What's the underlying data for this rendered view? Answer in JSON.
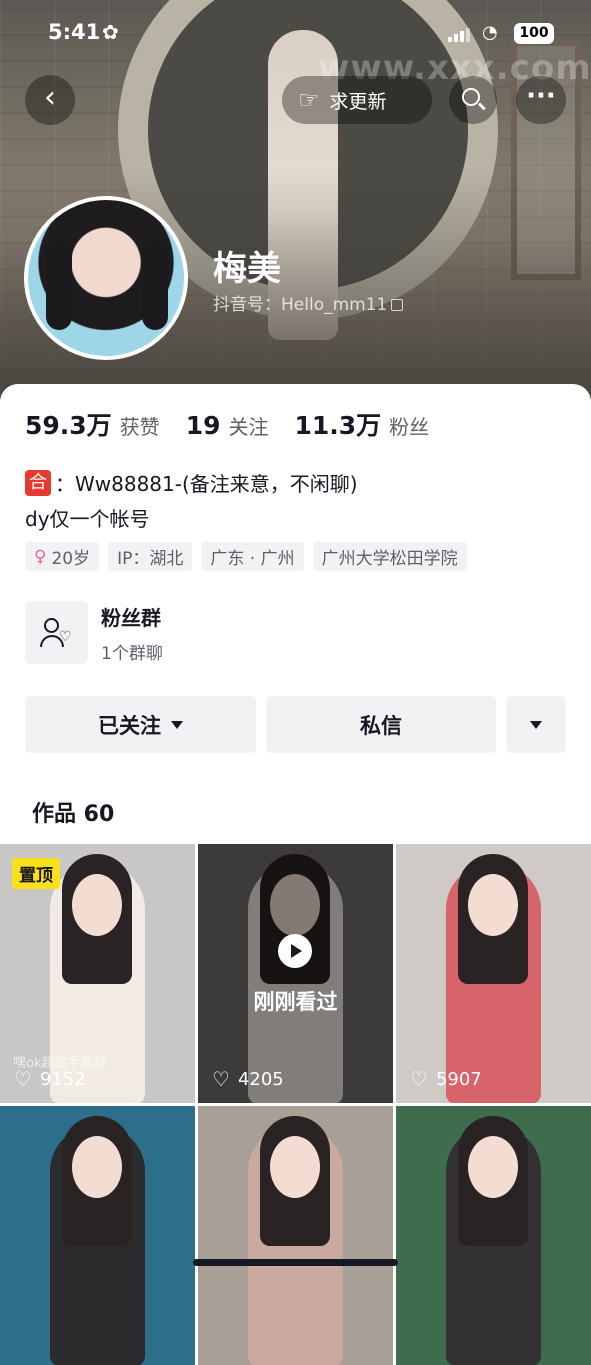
{
  "status_bar": {
    "time": "5:41",
    "flower": "✿",
    "battery": "100"
  },
  "header": {
    "watermark": "www.xxx.com",
    "request_update_label": "求更新",
    "back_icon": "chevron-left-icon",
    "search_icon": "search-icon",
    "more_icon": "more-dots-icon"
  },
  "profile": {
    "nickname": "梅美",
    "douyin_id": "抖音号：Hello_mm11"
  },
  "stats": [
    {
      "value": "59.3万",
      "label": "获赞"
    },
    {
      "value": "19",
      "label": "关注"
    },
    {
      "value": "11.3万",
      "label": "粉丝"
    }
  ],
  "bio": {
    "line1_icon": "合",
    "line1": "：Ww88881-(备注来意，不闲聊)",
    "line2": "dy仅一个帐号"
  },
  "tags": [
    {
      "label": "20岁",
      "icon": "♀"
    },
    {
      "label": "IP：湖北"
    },
    {
      "label": "广东 · 广州"
    },
    {
      "label": "广州大学松田学院"
    }
  ],
  "fans_group": {
    "title": "粉丝群",
    "subtitle": "1个群聊"
  },
  "actions": {
    "follow": "已关注",
    "message": "私信"
  },
  "works": {
    "title": "作品 60",
    "items": [
      {
        "pinned_label": "置顶",
        "overlay": "嘿ok超甜手势舞",
        "likes": "9152",
        "bg": "#c9c7c6",
        "cloth": "#f1ebe3"
      },
      {
        "watched_label": "刚刚看过",
        "likes": "4205",
        "bg": "#6e6c6b",
        "cloth": "#e9e4de"
      },
      {
        "likes": "5907",
        "bg": "#cfcac6",
        "cloth": "#d7636b"
      },
      {
        "bg": "#2d6f8b",
        "cloth": "#2b2b2e"
      },
      {
        "bg": "#a89f97",
        "cloth": "#c9a9a0"
      },
      {
        "bg": "#3e6d4e",
        "cloth": "#333134"
      }
    ]
  }
}
